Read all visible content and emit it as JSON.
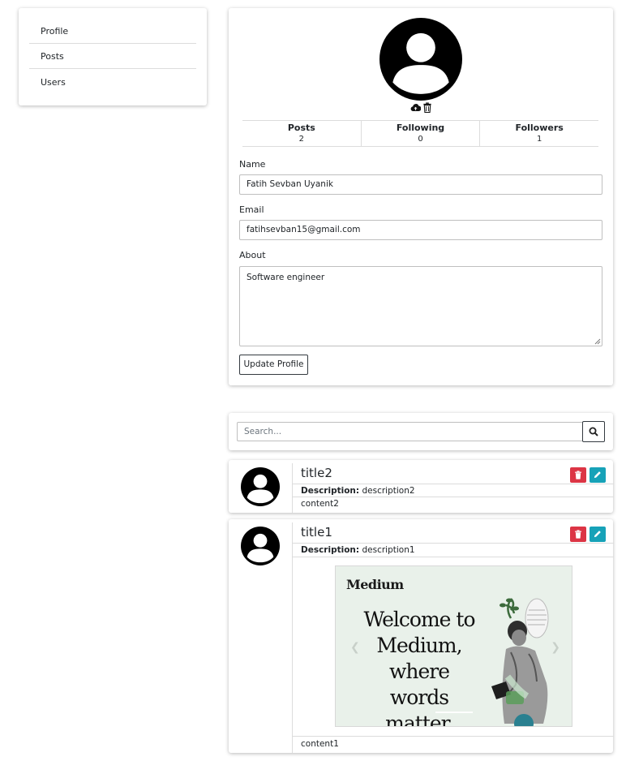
{
  "sidebar": {
    "items": [
      {
        "label": "Profile"
      },
      {
        "label": "Posts"
      },
      {
        "label": "Users"
      }
    ]
  },
  "profile": {
    "stats": [
      {
        "label": "Posts",
        "value": "2"
      },
      {
        "label": "Following",
        "value": "0"
      },
      {
        "label": "Followers",
        "value": "1"
      }
    ],
    "name_label": "Name",
    "name_value": "Fatih Sevban Uyanik",
    "email_label": "Email",
    "email_value": "fatihsevban15@gmail.com",
    "about_label": "About",
    "about_value": "Software engineer",
    "update_label": "Update Profile"
  },
  "search": {
    "placeholder": "Search..."
  },
  "posts": [
    {
      "title": "title2",
      "description_label": "Description:",
      "description": "description2",
      "content": "content2"
    },
    {
      "title": "title1",
      "description_label": "Description:",
      "description": "description1",
      "content": "content1",
      "image": {
        "brand": "Medium",
        "headline": "Welcome to Medium, where words matter."
      }
    }
  ],
  "colors": {
    "delete": "#dc3545",
    "edit": "#17a2b8",
    "image_bg": "#e9f1ea"
  },
  "icons": [
    "user-avatar-icon",
    "cloud-upload-icon",
    "trash-icon",
    "search-icon",
    "pencil-icon",
    "chevron-left-icon",
    "chevron-right-icon"
  ]
}
